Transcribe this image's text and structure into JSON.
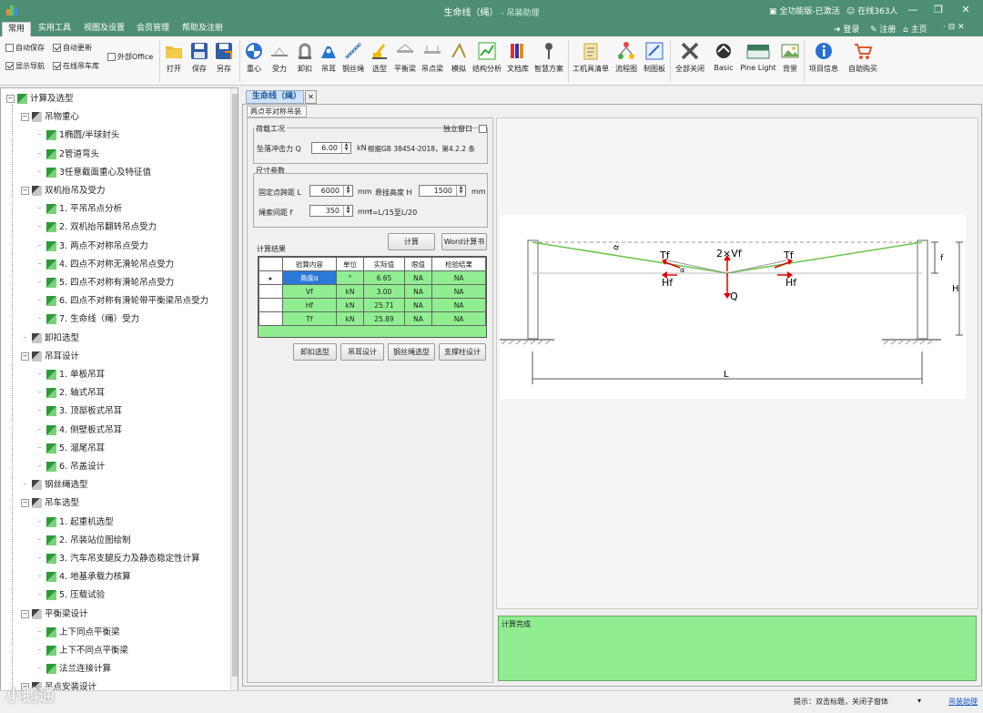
{
  "app": {
    "title": "生命线（绳）",
    "subtitle": " - 吊装助理",
    "license": "全功能版-已激活",
    "online": "在线363人",
    "login": "登录",
    "register": "注册",
    "home": "主页"
  },
  "menu": [
    "常用",
    "实用工具",
    "视图及设置",
    "会员管理",
    "帮助及注册"
  ],
  "ribbon": {
    "checks": [
      {
        "label": "自动保存",
        "checked": false
      },
      {
        "label": "自动更新",
        "checked": true
      },
      {
        "label": "显示导航",
        "checked": true
      },
      {
        "label": "在线吊车库",
        "checked": true
      },
      {
        "label": "外部Office",
        "checked": false
      }
    ],
    "buttons": [
      "打开",
      "保存",
      "另存",
      "重心",
      "受力",
      "卸扣",
      "吊耳",
      "钢丝绳",
      "选型",
      "平衡梁",
      "吊点梁",
      "模拟",
      "结构分析",
      "文档库",
      "智慧方案",
      "工机具清单",
      "流程图",
      "制图板",
      "全部关闭",
      "Basic",
      "Pine Light",
      "背景",
      "项目信息",
      "自助购买"
    ]
  },
  "tree": [
    {
      "label": "计算及选型",
      "level": 0,
      "type": "root"
    },
    {
      "label": "吊物重心",
      "level": 1,
      "type": "cat"
    },
    {
      "label": "1椭圆/半球封头",
      "level": 2,
      "type": "leaf"
    },
    {
      "label": "2管道弯头",
      "level": 2,
      "type": "leaf"
    },
    {
      "label": "3任意截面重心及特征值",
      "level": 2,
      "type": "leaf"
    },
    {
      "label": "双机抬吊及受力",
      "level": 1,
      "type": "cat"
    },
    {
      "label": "1. 平吊吊点分析",
      "level": 2,
      "type": "leaf"
    },
    {
      "label": "2. 双机抬吊翻转吊点受力",
      "level": 2,
      "type": "leaf"
    },
    {
      "label": "3. 两点不对称吊点受力",
      "level": 2,
      "type": "leaf"
    },
    {
      "label": "4. 四点不对称无滑轮吊点受力",
      "level": 2,
      "type": "leaf"
    },
    {
      "label": "5. 四点不对称有滑轮吊点受力",
      "level": 2,
      "type": "leaf"
    },
    {
      "label": "6. 四点不对称有滑轮带平衡梁吊点受力",
      "level": 2,
      "type": "leaf"
    },
    {
      "label": "7. 生命线（绳）受力",
      "level": 2,
      "type": "leaf"
    },
    {
      "label": "卸扣选型",
      "level": 1,
      "type": "single"
    },
    {
      "label": "吊耳设计",
      "level": 1,
      "type": "cat"
    },
    {
      "label": "1. 单板吊耳",
      "level": 2,
      "type": "leaf"
    },
    {
      "label": "2. 轴式吊耳",
      "level": 2,
      "type": "leaf"
    },
    {
      "label": "3. 顶部板式吊耳",
      "level": 2,
      "type": "leaf"
    },
    {
      "label": "4. 侧壁板式吊耳",
      "level": 2,
      "type": "leaf"
    },
    {
      "label": "5. 溜尾吊耳",
      "level": 2,
      "type": "leaf"
    },
    {
      "label": "6. 吊盖设计",
      "level": 2,
      "type": "leaf"
    },
    {
      "label": "钢丝绳选型",
      "level": 1,
      "type": "single"
    },
    {
      "label": "吊车选型",
      "level": 1,
      "type": "cat"
    },
    {
      "label": "1. 起重机选型",
      "level": 2,
      "type": "leaf"
    },
    {
      "label": "2. 吊装站位图绘制",
      "level": 2,
      "type": "leaf"
    },
    {
      "label": "3. 汽车吊支腿反力及静态稳定性计算",
      "level": 2,
      "type": "leaf"
    },
    {
      "label": "4. 地基承载力核算",
      "level": 2,
      "type": "leaf"
    },
    {
      "label": "5. 压载试验",
      "level": 2,
      "type": "leaf"
    },
    {
      "label": "平衡梁设计",
      "level": 1,
      "type": "cat"
    },
    {
      "label": "上下同点平衡梁",
      "level": 2,
      "type": "leaf"
    },
    {
      "label": "上下不同点平衡梁",
      "level": 2,
      "type": "leaf"
    },
    {
      "label": "法兰连接计算",
      "level": 2,
      "type": "leaf"
    },
    {
      "label": "吊点安装设计",
      "level": 1,
      "type": "cat"
    }
  ],
  "doc": {
    "tab": "生命线（绳）",
    "subtab": "两点非对称吊装"
  },
  "form": {
    "load_group": "荷载工况",
    "independent": "独立窗口",
    "q_label": "坠落冲击力 Q",
    "q_value": "6.00",
    "q_unit": "kN",
    "q_note": "根据GB 38454-2018，第4.2.2 条",
    "dim_group": "尺寸参数",
    "l_label": "固定点跨距 L",
    "l_value": "6000",
    "l_unit": "mm",
    "h_label": "悬挂高度 H",
    "h_value": "1500",
    "h_unit": "mm",
    "f_label": "绳索间距 f",
    "f_value": "350",
    "f_unit": "mm",
    "f_note": "f=L/15至L/20",
    "calc": "计算",
    "word": "Word计算书",
    "results_label": "计算结果"
  },
  "results": {
    "headers": [
      "验算内容",
      "单位",
      "实际值",
      "限值",
      "检验结果"
    ],
    "rows": [
      [
        "角度α",
        "°",
        "6.65",
        "NA",
        "NA"
      ],
      [
        "Vf",
        "kN",
        "3.00",
        "NA",
        "NA"
      ],
      [
        "Hf",
        "kN",
        "25.71",
        "NA",
        "NA"
      ],
      [
        "Tf",
        "kN",
        "25.89",
        "NA",
        "NA"
      ]
    ]
  },
  "actions": [
    "卸扣选型",
    "吊耳设计",
    "钢丝绳选型",
    "支撑柱设计"
  ],
  "diagram": {
    "tf_left": "Tf",
    "tf_right": "Tf",
    "vf": "2×Vf",
    "hf_left": "Hf",
    "hf_right": "Hf",
    "q": "Q",
    "alpha": "α",
    "alpha2": "α",
    "f": "f",
    "h": "H",
    "l": "L"
  },
  "status": {
    "output": "计算完成",
    "hint": "提示：双击标题，关闭子窗体",
    "link": "吊装助理",
    "watermark": "小鹅通"
  }
}
